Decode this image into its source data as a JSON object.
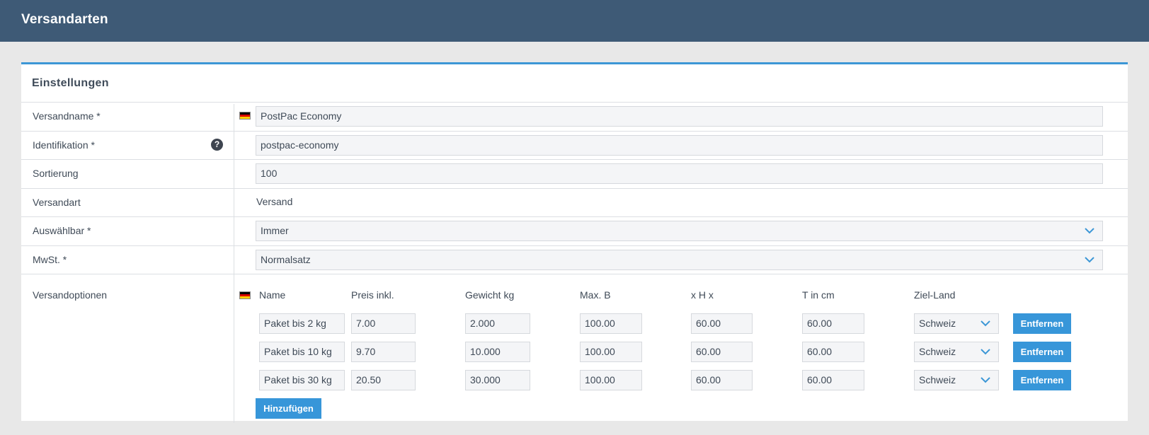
{
  "header": {
    "title": "Versandarten"
  },
  "panel": {
    "heading": "Einstellungen",
    "fields": {
      "name": {
        "label": "Versandname *",
        "value": "PostPac Economy"
      },
      "identification": {
        "label": "Identifikation *",
        "value": "postpac-economy"
      },
      "sorting": {
        "label": "Sortierung",
        "value": "100"
      },
      "type": {
        "label": "Versandart",
        "value": "Versand"
      },
      "selectable": {
        "label": "Auswählbar *",
        "value": "Immer"
      },
      "vat": {
        "label": "MwSt. *",
        "value": "Normalsatz"
      }
    },
    "options": {
      "label": "Versandoptionen",
      "columns": [
        "Name",
        "Preis inkl.",
        "Gewicht kg",
        "Max. B",
        "x H x",
        "T in cm",
        "Ziel-Land"
      ],
      "rows": [
        {
          "name": "Paket bis 2 kg",
          "price": "7.00",
          "weight": "2.000",
          "width": "100.00",
          "height": "60.00",
          "depth": "60.00",
          "country": "Schweiz"
        },
        {
          "name": "Paket bis 10 kg",
          "price": "9.70",
          "weight": "10.000",
          "width": "100.00",
          "height": "60.00",
          "depth": "60.00",
          "country": "Schweiz"
        },
        {
          "name": "Paket bis 30 kg",
          "price": "20.50",
          "weight": "30.000",
          "width": "100.00",
          "height": "60.00",
          "depth": "60.00",
          "country": "Schweiz"
        }
      ],
      "remove_label": "Entfernen",
      "add_label": "Hinzufügen"
    }
  },
  "colors": {
    "header_bg": "#3e5a76",
    "accent": "#3796d9",
    "page_bg": "#e8e8e8"
  },
  "icons": [
    "flag-de-icon",
    "help-icon",
    "chevron-down-icon"
  ]
}
